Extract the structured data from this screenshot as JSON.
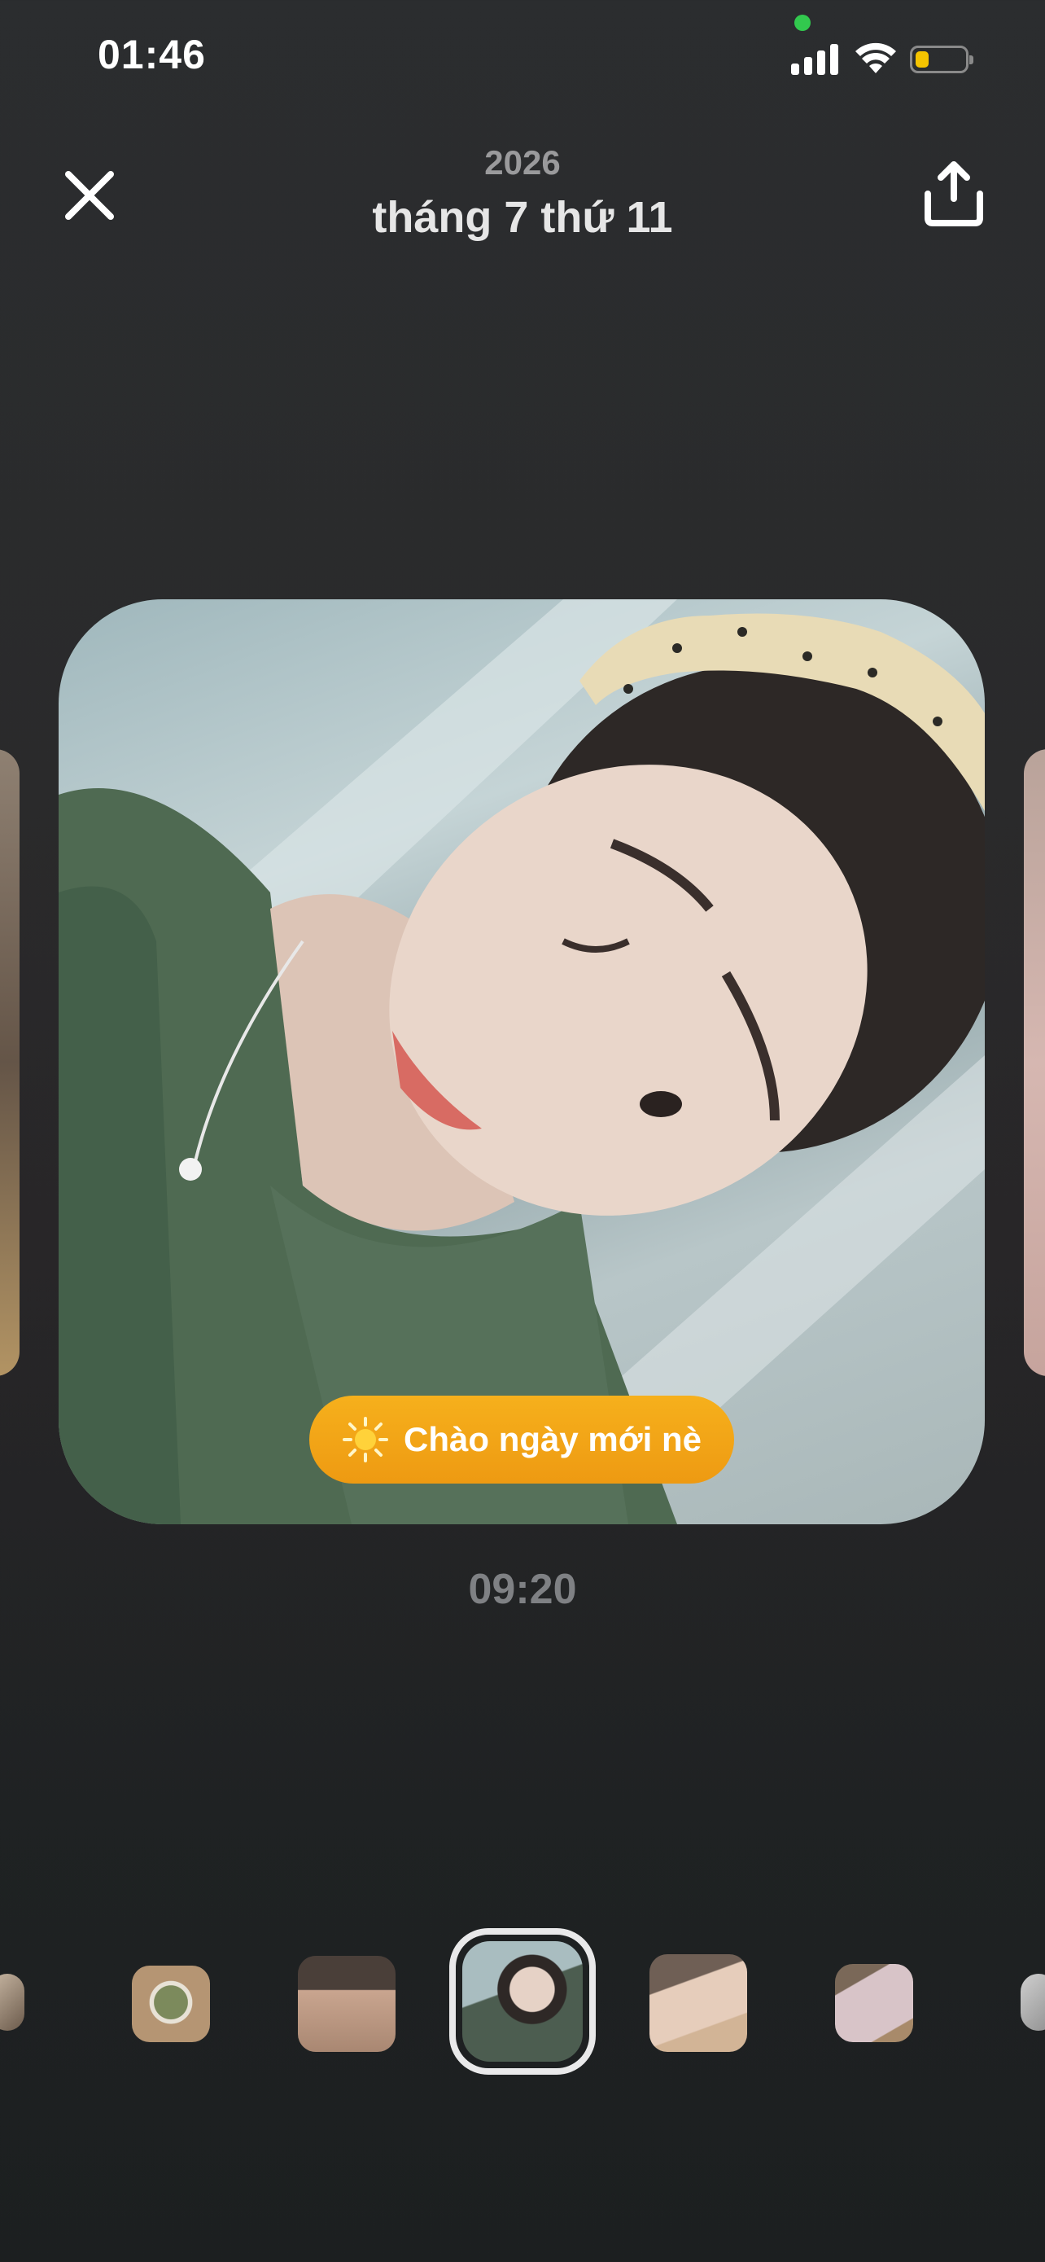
{
  "status_bar": {
    "time": "01:46",
    "recording_indicator_color": "#32c94e",
    "battery_color": "#f5c400"
  },
  "header": {
    "year": "2026",
    "date": "tháng 7 thứ 11",
    "close_icon": "close-icon",
    "share_icon": "share-upload-icon"
  },
  "photo": {
    "caption": "Chào ngày mới nè",
    "caption_icon": "sun-icon",
    "caption_color": "#f2a617",
    "time": "09:20"
  },
  "thumbnails": [
    {
      "name": "thumb-partial-left",
      "colors": [
        "#c9b8a4",
        "#6b5a4b"
      ]
    },
    {
      "name": "thumb-pho-bowl",
      "colors": [
        "#5d6f4d",
        "#b59573"
      ]
    },
    {
      "name": "thumb-person-forehead",
      "colors": [
        "#6b5c52",
        "#c9a58f"
      ]
    },
    {
      "name": "thumb-selfie-selected",
      "colors": [
        "#4c5d50",
        "#a9bdc0"
      ],
      "selected": true
    },
    {
      "name": "thumb-hand-comb",
      "colors": [
        "#6f5f55",
        "#e6cdbb"
      ]
    },
    {
      "name": "thumb-hand-item",
      "colors": [
        "#7a6858",
        "#d8c4c8"
      ]
    },
    {
      "name": "thumb-partial-right",
      "colors": [
        "#8e8e8e",
        "#cfcfcf"
      ]
    }
  ]
}
